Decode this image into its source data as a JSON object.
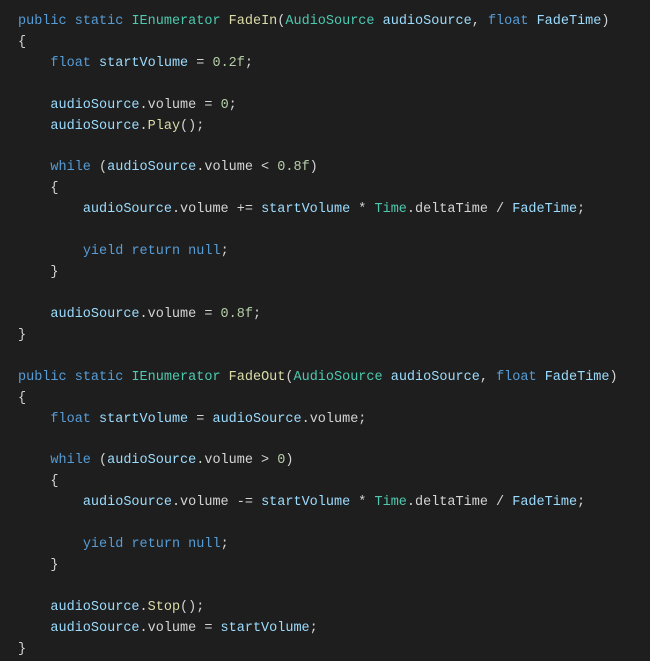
{
  "code": {
    "fn1": {
      "sig_public": "public",
      "sig_static": "static",
      "sig_type": "IEnumerator",
      "sig_name": "FadeIn",
      "sig_p1_type": "AudioSource",
      "sig_p1_name": "audioSource",
      "sig_p2_type": "float",
      "sig_p2_name": "FadeTime",
      "l1_kw": "float",
      "l1_var": "startVolume",
      "l1_eq": " = ",
      "l1_val": "0.2f",
      "l2a": "audioSource",
      "l2b": ".volume",
      "l2c": " = ",
      "l2d": "0",
      "l3a": "audioSource",
      "l3b": ".",
      "l3c": "Play",
      "l3d": "();",
      "wh_kw": "while",
      "wh_a": "audioSource",
      "wh_b": ".volume < ",
      "wh_c": "0.8f",
      "b1a": "audioSource",
      "b1b": ".volume += ",
      "b1c": "startVolume",
      "b1d": " * ",
      "b1e": "Time",
      "b1f": ".deltaTime / ",
      "b1g": "FadeTime",
      "y1": "yield",
      "y2": "return",
      "y3": "null",
      "end_a": "audioSource",
      "end_b": ".volume = ",
      "end_c": "0.8f"
    },
    "fn2": {
      "sig_public": "public",
      "sig_static": "static",
      "sig_type": "IEnumerator",
      "sig_name": "FadeOut",
      "sig_p1_type": "AudioSource",
      "sig_p1_name": "audioSource",
      "sig_p2_type": "float",
      "sig_p2_name": "FadeTime",
      "l1_kw": "float",
      "l1_var": "startVolume",
      "l1_eq": " = ",
      "l1_a": "audioSource",
      "l1_b": ".volume;",
      "wh_kw": "while",
      "wh_a": "audioSource",
      "wh_b": ".volume > ",
      "wh_c": "0",
      "b1a": "audioSource",
      "b1b": ".volume -= ",
      "b1c": "startVolume",
      "b1d": " * ",
      "b1e": "Time",
      "b1f": ".deltaTime / ",
      "b1g": "FadeTime",
      "y1": "yield",
      "y2": "return",
      "y3": "null",
      "s1a": "audioSource",
      "s1b": ".",
      "s1c": "Stop",
      "s1d": "();",
      "e1a": "audioSource",
      "e1b": ".volume = ",
      "e1c": "startVolume",
      "e1d": ";"
    }
  }
}
